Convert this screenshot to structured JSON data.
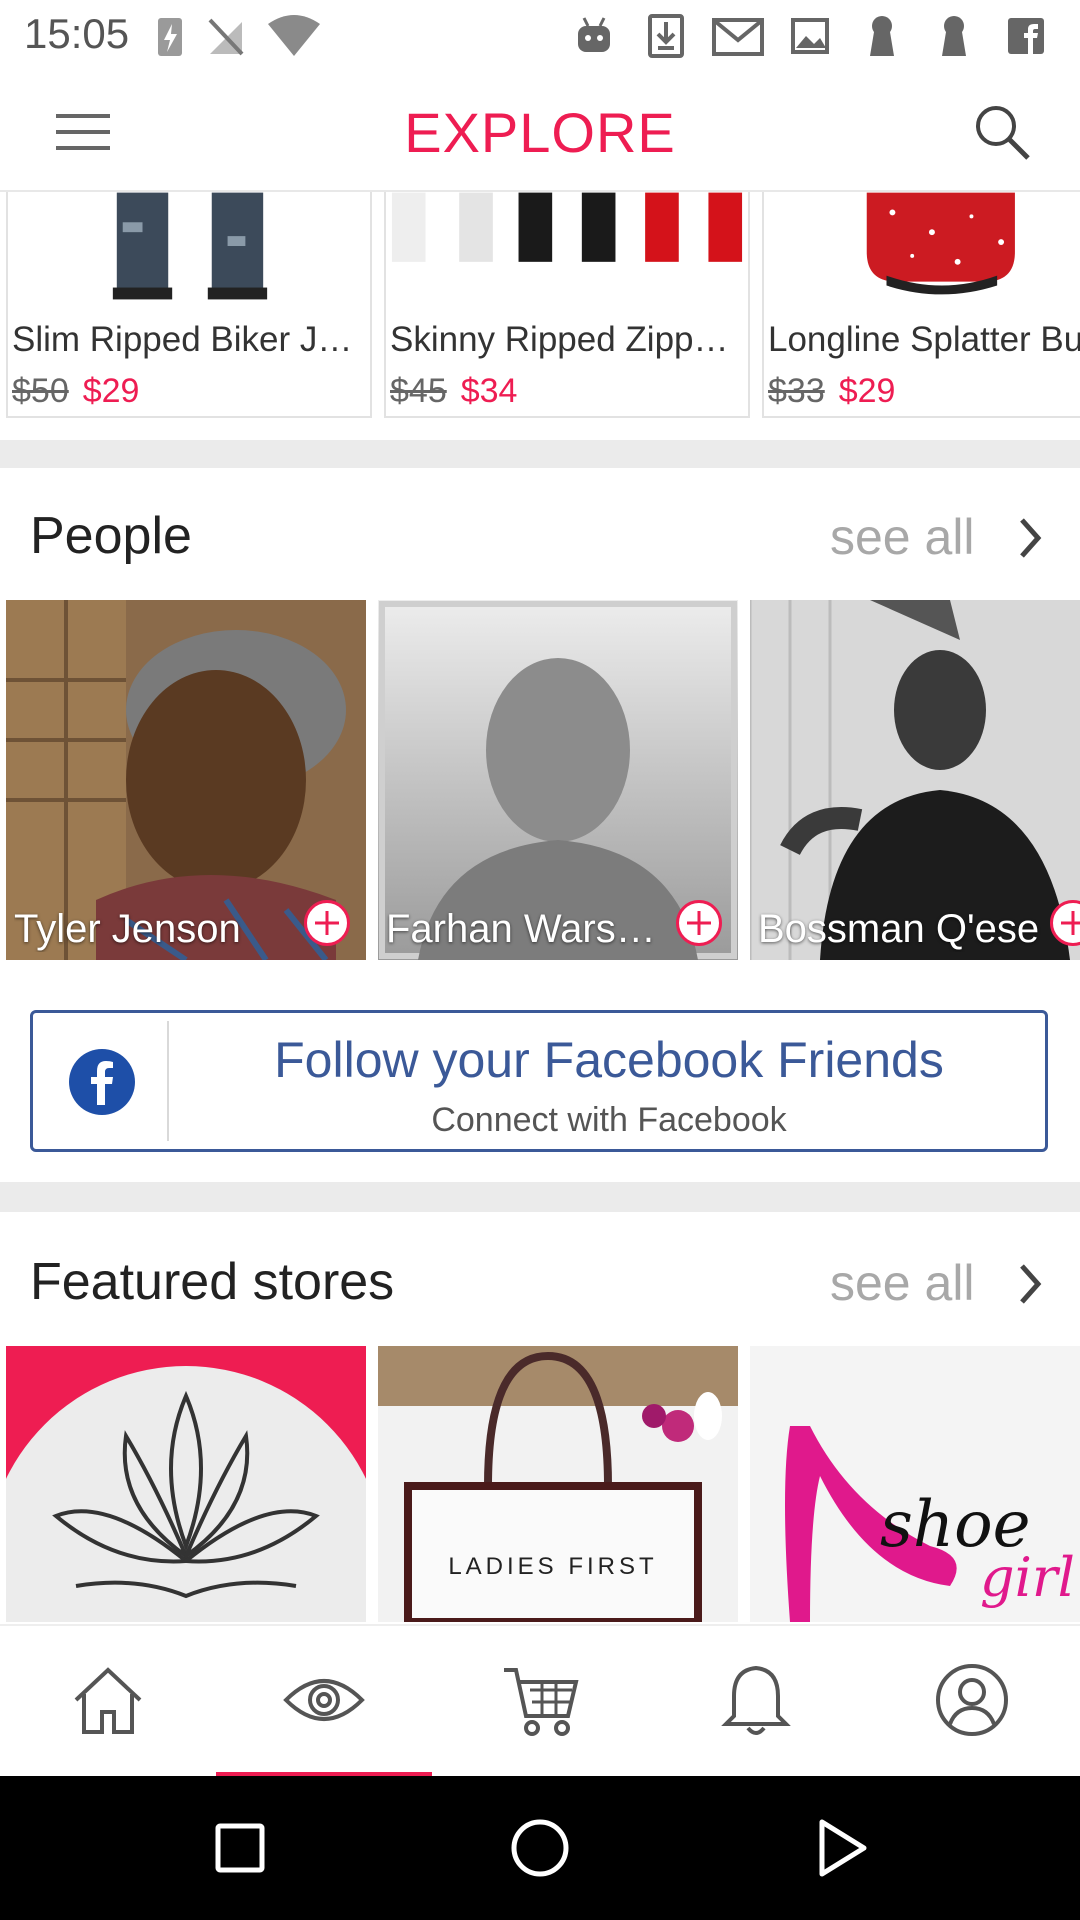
{
  "status_bar": {
    "time": "15:05"
  },
  "header": {
    "title": "EXPLORE"
  },
  "products": [
    {
      "name": "Slim Ripped Biker Je…",
      "old_price": "$50",
      "price": "$29"
    },
    {
      "name": "Skinny Ripped Zippe…",
      "old_price": "$45",
      "price": "$34"
    },
    {
      "name": "Longline Splatter Bu",
      "old_price": "$33",
      "price": "$29"
    }
  ],
  "people_section": {
    "title": "People",
    "see_all": "see all",
    "people": [
      {
        "name": "Tyler Jenson"
      },
      {
        "name": "Farhan Wars…"
      },
      {
        "name": "Bossman Q'ese"
      }
    ]
  },
  "facebook": {
    "title": "Follow your Facebook Friends",
    "subtitle": "Connect with Facebook"
  },
  "stores_section": {
    "title": "Featured stores",
    "see_all": "see all",
    "stores": [
      {
        "caption": ""
      },
      {
        "caption": "LADIES FIRST"
      },
      {
        "caption": "shoe girl"
      }
    ]
  },
  "bottom_nav": {
    "items": [
      "home",
      "explore",
      "cart",
      "notifications",
      "profile"
    ],
    "active": "explore"
  },
  "colors": {
    "accent": "#ee1d52",
    "facebook": "#3b5998"
  }
}
